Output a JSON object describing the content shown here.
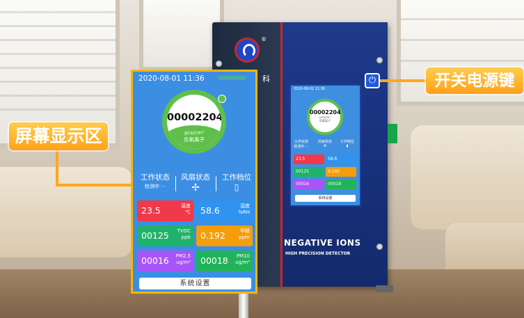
{
  "big_screen": {
    "time": "2020-08-01 11:36",
    "ion_value": "00002204",
    "ion_unit": "pcs/cm³",
    "ion_name": "负氧离子",
    "work_status_label": "工作状态",
    "work_status_value": "检测中 ···",
    "fan_status_label": "风扇状态",
    "fan_icon": "fan-icon",
    "gear_label": "工作档位",
    "gear_icon": "battery-level-icon",
    "temp_value": "23.5",
    "temp_label": "温度",
    "temp_unit": "℃",
    "hum_value": "58.6",
    "hum_label": "湿度",
    "hum_unit": "%RH",
    "tvoc_value": "00125",
    "tvoc_label": "TVOC",
    "tvoc_unit": "ppb",
    "hcho_value": "0.192",
    "hcho_label": "甲醛",
    "hcho_unit": "ppm",
    "pm25_value": "00016",
    "pm25_label": "PM2.5",
    "pm25_unit": "ug/m³",
    "pm10_value": "00018",
    "pm10_label": "PM10",
    "pm10_unit": "ug/m³",
    "settings_button": "系统设置"
  },
  "mini_screen": {
    "time": "2020-08-01 11:36",
    "ion_value": "00002204",
    "ion_unit": "pcs/cm³",
    "ion_name": "负氧离子",
    "work_status_label": "工作状态",
    "fan_status_label": "风扇状态",
    "gear_label": "工作档位",
    "work_status_value": "检测中 ···",
    "temp_value": "23.5",
    "hum_value": "58.6",
    "tvoc_value": "00125",
    "hcho_value": "0.192",
    "pm25_value": "00016",
    "pm10_value": "00018",
    "settings_button": "系统设置"
  },
  "device": {
    "brand_title": "NEGATIVE IONS",
    "brand_subtitle": "HIGH PRECISION DETECTOR",
    "logo_mark": "®",
    "badge_text": "科"
  },
  "callouts": {
    "screen_area": "屏幕显示区",
    "power_key": "开关电源键"
  },
  "colors": {
    "screen_bg": "#3c8ee3",
    "ring_green": "#5fbf4a",
    "temp_red": "#f0394a",
    "humidity_blue": "#2f93ef",
    "tvoc_green": "#20b26b",
    "hcho_orange": "#f59e0b",
    "pm25_purple": "#a855f7",
    "pm10_green": "#22b35a",
    "callout_orange": "#ffa21a"
  }
}
